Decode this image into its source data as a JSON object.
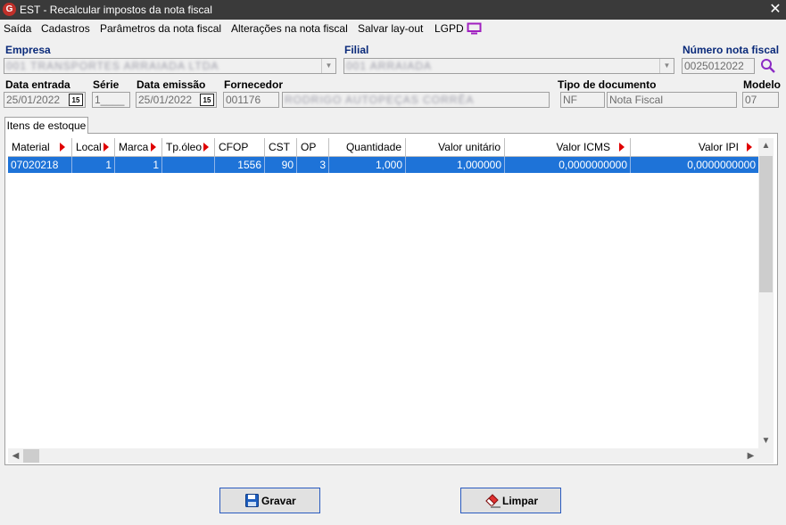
{
  "window": {
    "title": "EST - Recalcular impostos da nota fiscal",
    "close_glyph": "✕",
    "app_icon_letter": "G"
  },
  "menu": [
    {
      "label": "Saída"
    },
    {
      "label": "Cadastros"
    },
    {
      "label": "Parâmetros da nota fiscal"
    },
    {
      "label": "Alterações na nota fiscal"
    },
    {
      "label": "Salvar lay-out"
    },
    {
      "label": "LGPD"
    }
  ],
  "form": {
    "empresa_label": "Empresa",
    "empresa_value": "001 TRANSPORTES ARRAIADA LTDA",
    "filial_label": "Filial",
    "filial_value": "001 ARRAIADA",
    "numero_label": "Número nota fiscal",
    "numero_value": "0025012022",
    "data_entrada_label": "Data entrada",
    "data_entrada_value": "25/01/2022",
    "serie_label": "Série",
    "serie_value": "1____",
    "data_emissao_label": "Data emissão",
    "data_emissao_value": "25/01/2022",
    "fornecedor_label": "Fornecedor",
    "fornecedor_code": "001176",
    "fornecedor_name": "RODRIGO AUTOPEÇAS CORRÊA",
    "tipo_label": "Tipo de documento",
    "tipo_code": "NF",
    "tipo_name": "Nota Fiscal",
    "modelo_label": "Modelo",
    "modelo_value": "07",
    "calendar_glyph": "15"
  },
  "tab": {
    "label": "Itens de estoque"
  },
  "table": {
    "columns": [
      "Material",
      "Local",
      "Marca",
      "Tp.óleo",
      "CFOP",
      "CST",
      "OP",
      "Quantidade",
      "Valor unitário",
      "Valor ICMS",
      "Valor IPI"
    ],
    "rows": [
      [
        "07020218",
        "1",
        "1",
        "",
        "1556",
        "90",
        "3",
        "1,000",
        "1,000000",
        "0,0000000000",
        "0,0000000000"
      ]
    ]
  },
  "buttons": {
    "save": "Gravar",
    "clear": "Limpar"
  },
  "colors": {
    "titlebar": "#3a3a3a",
    "selected_row": "#1e73d8",
    "sort_arrow": "#e00000",
    "label_blue": "#0a2a7a"
  }
}
